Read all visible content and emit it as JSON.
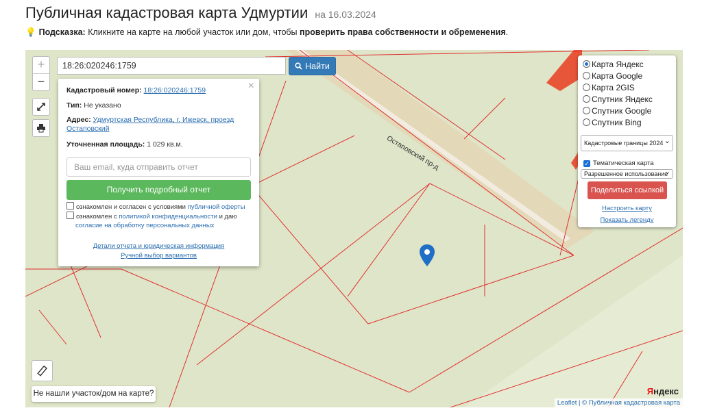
{
  "page": {
    "title": "Публичная кадастровая карта Удмуртии",
    "date": "на 16.03.2024",
    "hint_prefix": "Подсказка:",
    "hint_text": "Кликните на карте на любой участок или дом, чтобы",
    "hint_bold": "проверить права собственности и обременения",
    "hint_end": "."
  },
  "map": {
    "street_label": "Остаповский пр-д",
    "zoom_in": "+",
    "zoom_out": "−",
    "search_value": "18:26:020246:1759",
    "search_button": "Найти",
    "not_found_button": "Не нашли участок/дом на карте?",
    "attribution_leaflet": "Leaflet",
    "attribution_sep": " | © ",
    "attribution_pkk": "Публичная кадастровая карта",
    "yandex_logo_first": "Я",
    "yandex_logo_rest": "ндекс"
  },
  "popup": {
    "close": "×",
    "cadastral_label": "Кадастровый номер:",
    "cadastral_value": "18:26:020246:1759",
    "type_label": "Тип:",
    "type_value": "Не указано",
    "address_label": "Адрес:",
    "address_value": "Удмуртская Республика, г. Ижевск, проезд Остаповский",
    "area_label": "Уточненная площадь:",
    "area_value": "1 029 кв.м.",
    "email_placeholder": "Ваш email, куда отправить отчет",
    "report_button": "Получить подробный отчет",
    "consent1_text": "ознакомлен и согласен с условиями",
    "consent1_link": "публичной оферты",
    "consent2_text": "ознакомлен с",
    "consent2_link": "политикой конфиденциальности",
    "consent2_text2": "и даю",
    "consent2_link2": "согласие на обработку персональных данных",
    "details_link": "Детали отчета и юридическая информация",
    "manual_link": "Ручной выбор вариантов"
  },
  "layers": {
    "options": [
      {
        "label": "Карта Яндекс",
        "selected": true
      },
      {
        "label": "Карта Google",
        "selected": false
      },
      {
        "label": "Карта 2GIS",
        "selected": false
      },
      {
        "label": "Спутник Яндекс",
        "selected": false
      },
      {
        "label": "Спутник Google",
        "selected": false
      },
      {
        "label": "Спутник Bing",
        "selected": false
      }
    ],
    "boundaries_select": "Кадастровые границы 2024",
    "thematic_label": "Тематическая карта",
    "thematic_checked": true,
    "usage_select": "Разрешенное использование",
    "share_button": "Поделиться ссылкой",
    "configure_link": "Настроить карту",
    "legend_link": "Показать легенду"
  },
  "colors": {
    "map_background": "#dfe5c8",
    "parcel_border": "#e03030",
    "road": "#ddc7a0",
    "search_button": "#337ab7",
    "report_button": "#5cb85c",
    "share_button": "#d9534f",
    "link": "#2a6db0",
    "pin": "#1f6fc6"
  }
}
